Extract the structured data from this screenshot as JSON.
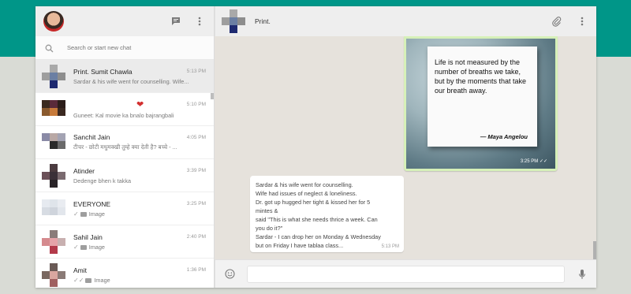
{
  "sidebar": {
    "search_placeholder": "Search or start new chat",
    "chats": [
      {
        "name": "Print. Sumit Chawla",
        "time": "5:13 PM",
        "preview": "Sardar & his wife went for counselling. Wife..."
      },
      {
        "name": "",
        "time": "5:10 PM",
        "preview": "Guneet: Kal movie ka bnalo bajrangbali"
      },
      {
        "name": "Sanchit Jain",
        "time": "4:05 PM",
        "preview": "टीचर - छोटी मधुमक्खी तुम्हे क्या देती है? बच्चे - ..."
      },
      {
        "name": "Atinder",
        "time": "3:39 PM",
        "preview": "Dedenge bhen k takka"
      },
      {
        "name": "EVERYONE",
        "time": "3:25 PM",
        "preview": "Image"
      },
      {
        "name": "Sahil Jain",
        "time": "2:40 PM",
        "preview": "Image"
      },
      {
        "name": "Amit",
        "time": "1:36 PM",
        "preview": "Image"
      }
    ]
  },
  "conversation": {
    "title": "Print.",
    "image_message": {
      "quote": "Life is not measured by the number of breaths we take, but by the moments that take our breath away.",
      "author": "— Maya Angelou",
      "time": "3:25 PM"
    },
    "text_message": {
      "lines": [
        "Sardar & his wife went for counselling.",
        "Wife had issues of neglect & loneliness.",
        "Dr. got up hugged her tight & kissed her for 5",
        "mintes &",
        "said \"This is what she needs thrice a week. Can",
        "you do it?\"",
        "Sardar - I can drop her on Monday & Wednesday",
        "but on Friday I have tablaa class..."
      ],
      "time": "5:13 PM"
    },
    "composer_placeholder": ""
  },
  "colors": {
    "brand": "#009688",
    "outgoing_bubble": "#dcf8c6",
    "unread_heart": "#d32f2f"
  },
  "icons": [
    "new-chat-icon",
    "menu-icon",
    "search-icon",
    "attach-icon",
    "emoji-icon",
    "mic-icon",
    "heart-emoji-icon",
    "camera-icon",
    "double-check-icon"
  ]
}
